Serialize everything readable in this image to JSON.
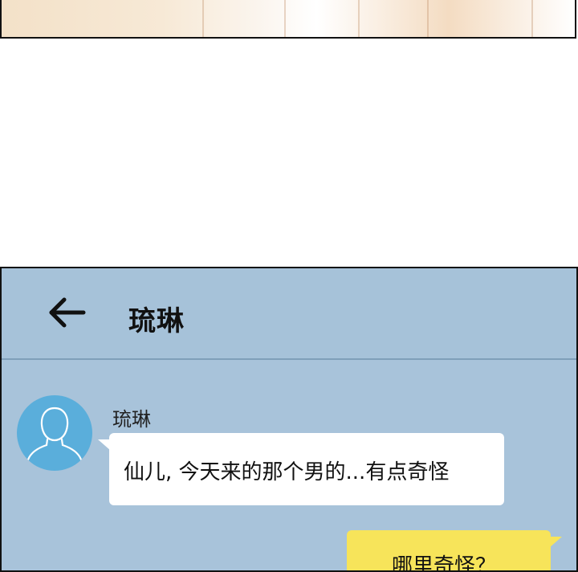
{
  "chat": {
    "contact_name": "琉琳",
    "messages": [
      {
        "sender": "琉琳",
        "side": "left",
        "text": "仙儿, 今天来的那个男的...有点奇怪"
      },
      {
        "sender": "self",
        "side": "right",
        "text": "哪里奇怪？"
      }
    ]
  },
  "colors": {
    "chat_background": "#a8c3da",
    "incoming_bubble": "#ffffff",
    "outgoing_bubble": "#f7e45a",
    "avatar": "#5aaedb"
  },
  "icons": {
    "back": "arrow-left-icon",
    "avatar": "person-silhouette-icon"
  }
}
